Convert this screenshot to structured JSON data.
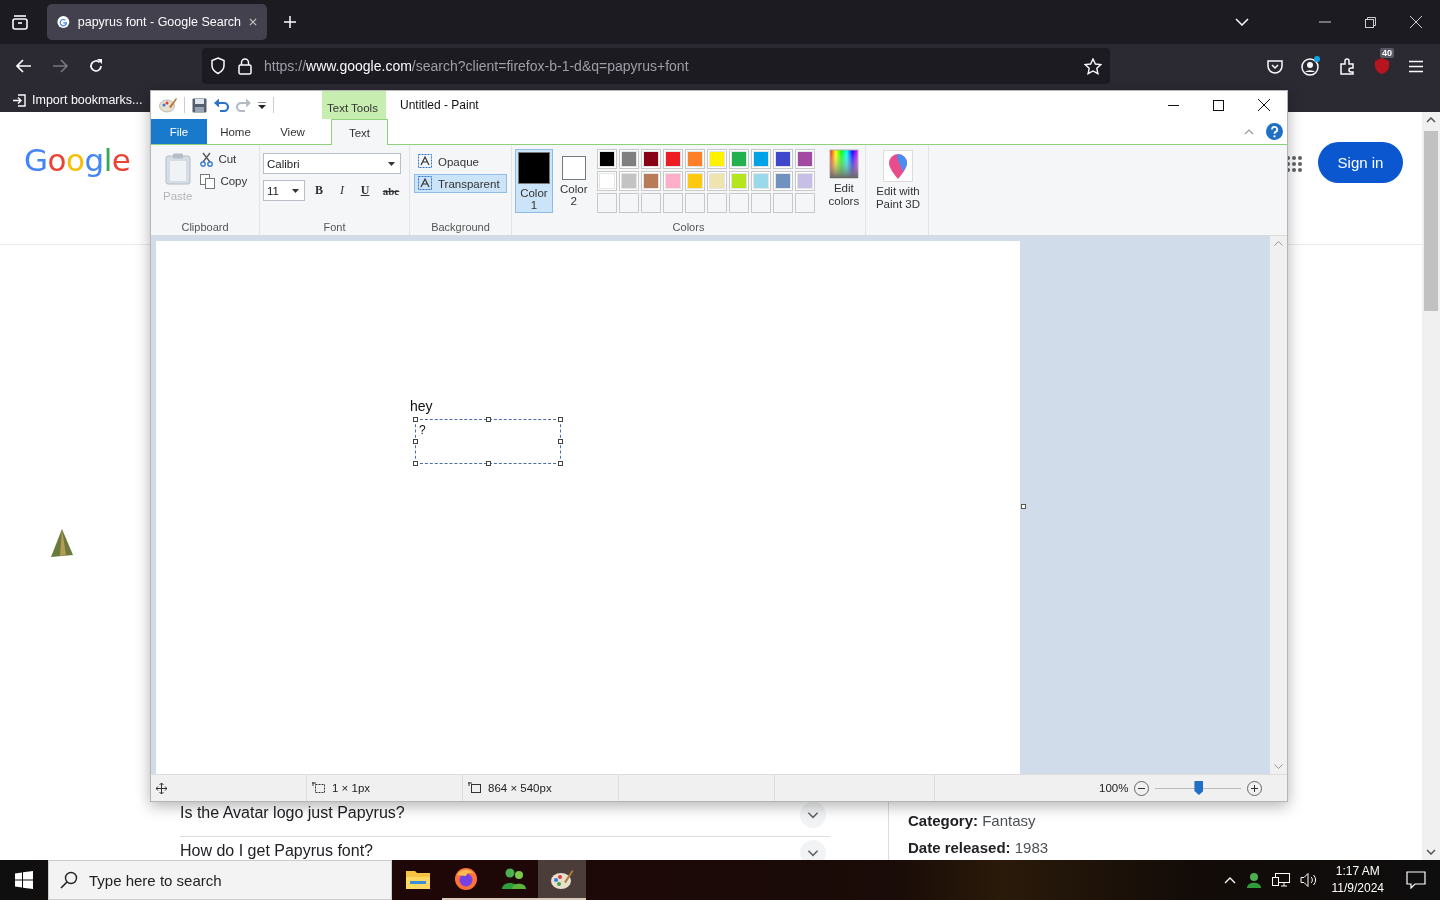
{
  "browser": {
    "tabs": [
      {
        "title": "papyrus font - Google Search",
        "selected": true
      }
    ],
    "url": {
      "scheme": "https://",
      "host": "www.google.com",
      "path": "/search?client=firefox-b-1-d&q=papyrus+font"
    },
    "extension_badge": "40",
    "bookmarks": [
      "Import bookmarks..."
    ]
  },
  "page": {
    "logo": "Google",
    "sign_in": "Sign in",
    "questions": [
      "Is the Avatar logo just Papyrus?",
      "How do I get Papyrus font?"
    ],
    "facts": [
      "**Category:** Fantasy",
      "**Date released:** 1983"
    ]
  },
  "paint": {
    "title": "Untitled - Paint",
    "context_tab": "Text Tools",
    "tabs": [
      {
        "label": "File",
        "kind": "menu",
        "selected": false
      },
      {
        "label": "Home",
        "kind": "tab",
        "selected": false
      },
      {
        "label": "View",
        "kind": "tab",
        "selected": false
      },
      {
        "label": "Text",
        "kind": "tab",
        "selected": true
      }
    ],
    "clipboard": {
      "label": "Clipboard",
      "paste": {
        "label": "Paste",
        "disabled": true
      },
      "cut": "Cut",
      "copy": "Copy"
    },
    "font": {
      "label": "Font",
      "family": "Calibri",
      "size": "11",
      "styles": [
        {
          "label": "B",
          "kind": "bold"
        },
        {
          "label": "I",
          "kind": "italic"
        },
        {
          "label": "U",
          "kind": "underline"
        },
        {
          "label": "abc",
          "kind": "strikethrough"
        }
      ]
    },
    "background": {
      "label": "Background",
      "options": [
        {
          "label": "Opaque",
          "selected": false
        },
        {
          "label": "Transparent",
          "selected": true
        }
      ]
    },
    "colors": {
      "label": "Colors",
      "slots": [
        {
          "label": "Color 1",
          "color": "#000000",
          "selected": true
        },
        {
          "label": "Color 2",
          "color": "#ffffff",
          "selected": false
        }
      ],
      "palette": [
        {
          "color": "#000000"
        },
        {
          "color": "#7f7f7f"
        },
        {
          "color": "#880015"
        },
        {
          "color": "#ed1c24"
        },
        {
          "color": "#ff7f27"
        },
        {
          "color": "#fff200"
        },
        {
          "color": "#22b14c"
        },
        {
          "color": "#00a2e8"
        },
        {
          "color": "#3f48cc"
        },
        {
          "color": "#a349a4"
        },
        {
          "color": "#ffffff"
        },
        {
          "color": "#c3c3c3"
        },
        {
          "color": "#b97a57"
        },
        {
          "color": "#ffaec9"
        },
        {
          "color": "#ffc90e"
        },
        {
          "color": "#efe4b0"
        },
        {
          "color": "#b5e61d"
        },
        {
          "color": "#99d9ea"
        },
        {
          "color": "#7092be"
        },
        {
          "color": "#c8bfe7"
        }
      ],
      "edit_colors": "Edit colors"
    },
    "paint3d": "Edit with Paint 3D",
    "canvas": {
      "placed_text": "hey",
      "text_box": "?"
    },
    "status": {
      "selection_size": "1 × 1px",
      "canvas_size": "864 × 540px",
      "zoom": "100%",
      "zoom_slider": {
        "level": 0.5
      }
    }
  },
  "taskbar": {
    "search_placeholder": "Type here to search",
    "apps": [
      {
        "kind": "files",
        "running": false,
        "selected": false
      },
      {
        "kind": "firefox",
        "running": true,
        "selected": false
      },
      {
        "kind": "people",
        "running": true,
        "selected": false
      },
      {
        "kind": "paint",
        "running": true,
        "selected": true
      }
    ],
    "time": "1:17 AM",
    "date": "11/9/2024"
  }
}
